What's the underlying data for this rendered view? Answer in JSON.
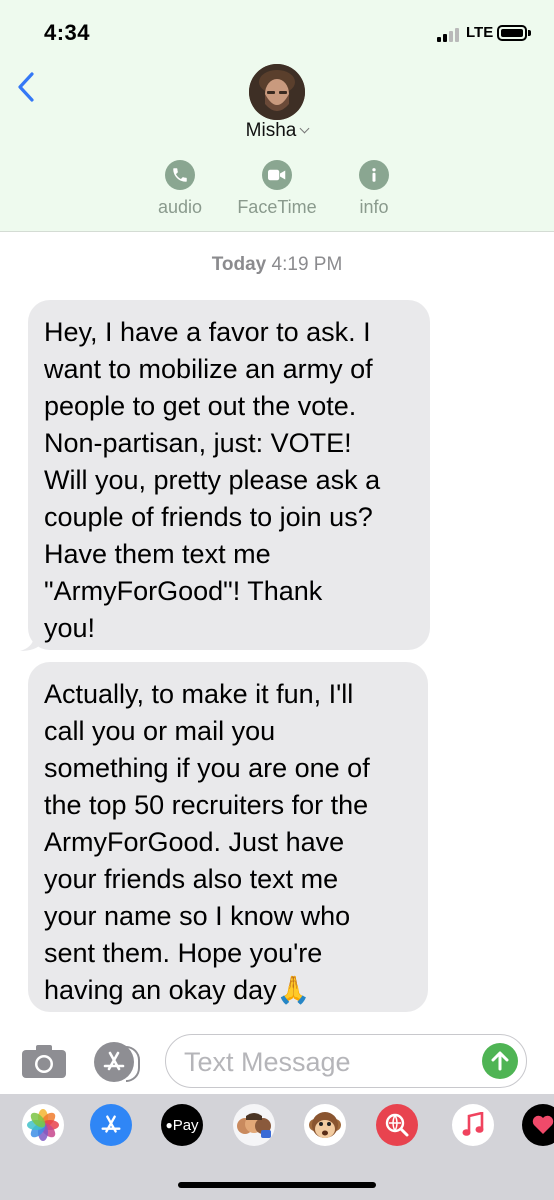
{
  "status_bar": {
    "time": "4:34",
    "network": "LTE"
  },
  "header": {
    "contact_name": "Misha",
    "actions": [
      {
        "label": "audio",
        "icon": "phone-icon"
      },
      {
        "label": "FaceTime",
        "icon": "video-camera-icon"
      },
      {
        "label": "info",
        "icon": "info-icon"
      }
    ]
  },
  "conversation": {
    "date_label": "Today",
    "time_label": "4:19 PM",
    "messages": [
      {
        "lines": [
          "Hey, I have a favor to ask. I",
          "want to mobilize an army of",
          "people to get out the vote.",
          "Non-partisan, just: VOTE!",
          "Will you, pretty please ask a",
          "couple of friends to join us?",
          "Have them text me",
          "\"ArmyForGood\"! Thank",
          "you!"
        ]
      },
      {
        "lines": [
          "Actually, to make it fun, I'll",
          "call you or mail you",
          "something if you are one of",
          "the top 50 recruiters for the",
          "ArmyForGood. Just have",
          "your friends also text me",
          "your name so I know who",
          "sent them. Hope you're",
          "having an okay day🙏"
        ]
      }
    ]
  },
  "composer": {
    "placeholder": "Text Message"
  },
  "app_drawer": {
    "apps": [
      {
        "name": "photos-icon"
      },
      {
        "name": "app-store-icon"
      },
      {
        "name": "apple-pay-icon",
        "label": "Pay"
      },
      {
        "name": "memoji-icon"
      },
      {
        "name": "animoji-icon"
      },
      {
        "name": "web-search-icon"
      },
      {
        "name": "music-icon"
      },
      {
        "name": "digital-touch-icon"
      }
    ]
  },
  "colors": {
    "header_bg": "#eefaee",
    "bubble_bg": "#e9e9eb",
    "back_blue": "#3478f6",
    "action_green": "#8aa691",
    "send_green": "#4fb454"
  }
}
